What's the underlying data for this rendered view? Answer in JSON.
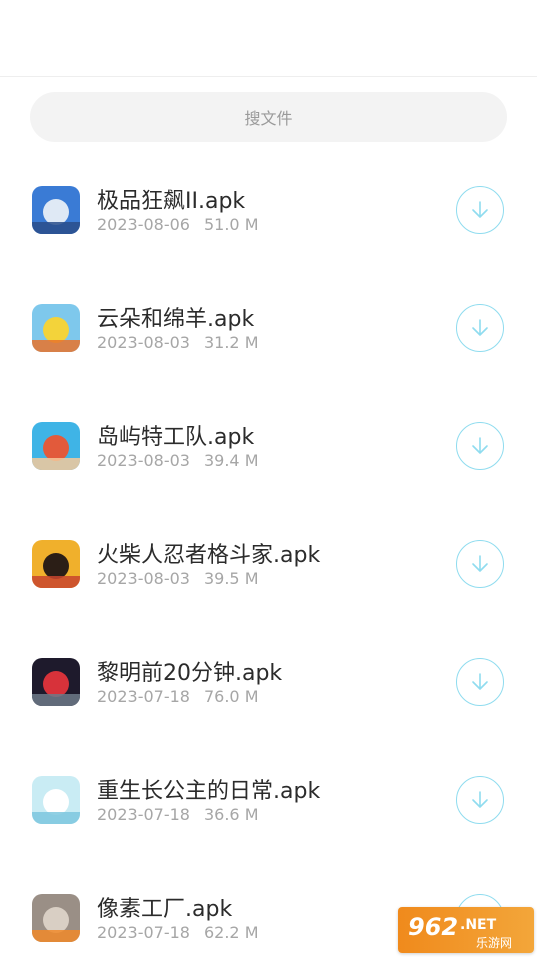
{
  "search": {
    "placeholder": "搜文件"
  },
  "files": [
    {
      "name": "极品狂飙II.apk",
      "date": "2023-08-06",
      "size": "51.0 M",
      "icon": "racing-car-game-icon",
      "colors": [
        "#3a7bd5",
        "#dfe9f5",
        "#2a4d8a"
      ]
    },
    {
      "name": "云朵和绵羊.apk",
      "date": "2023-08-03",
      "size": "31.2 M",
      "icon": "sheep-cloud-game-icon",
      "colors": [
        "#7ec8ec",
        "#f3d33a",
        "#e8732c"
      ]
    },
    {
      "name": "岛屿特工队.apk",
      "date": "2023-08-03",
      "size": "39.4 M",
      "icon": "island-agent-game-icon",
      "colors": [
        "#3fb4e6",
        "#e25a3b",
        "#f5c99a"
      ]
    },
    {
      "name": "火柴人忍者格斗家.apk",
      "date": "2023-08-03",
      "size": "39.5 M",
      "icon": "stickman-ninja-game-icon",
      "colors": [
        "#f0b02c",
        "#2b1e16",
        "#c8452e"
      ]
    },
    {
      "name": "黎明前20分钟.apk",
      "date": "2023-07-18",
      "size": "76.0 M",
      "icon": "red-hair-character-game-icon",
      "colors": [
        "#1e1a2c",
        "#d7323a",
        "#6d7a88"
      ]
    },
    {
      "name": "重生长公主的日常.apk",
      "date": "2023-07-18",
      "size": "36.6 M",
      "icon": "princess-daily-game-icon",
      "colors": [
        "#c9ecf4",
        "#ffffff",
        "#7cc7de"
      ]
    },
    {
      "name": "像素工厂.apk",
      "date": "2023-07-18",
      "size": "62.2 M",
      "icon": "pixel-factory-game-icon",
      "colors": [
        "#9a8f86",
        "#d9cfc4",
        "#f08a2a"
      ]
    }
  ],
  "watermark": {
    "text": "962.NET",
    "subtext": "乐游网"
  },
  "theme": {
    "accent": "#8fdcef",
    "secondary_text": "#a6a6a6"
  }
}
